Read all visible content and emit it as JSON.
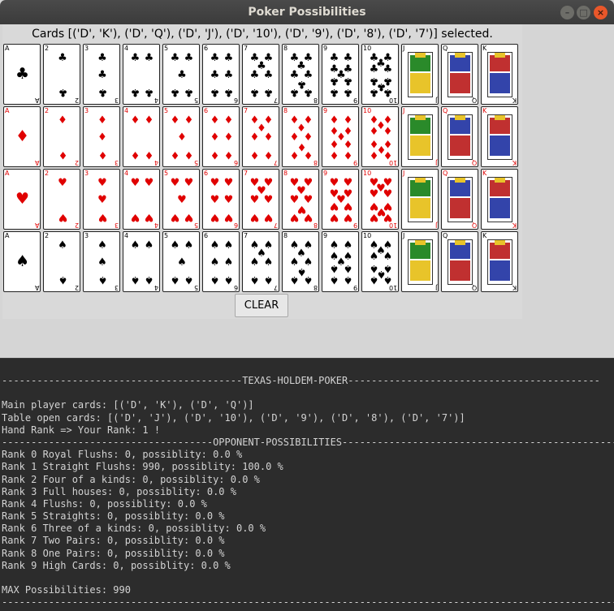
{
  "window": {
    "title": "Poker Possibilities",
    "controls": {
      "minimize": "–",
      "maximize": "□",
      "close": "×"
    }
  },
  "status_text": "Cards [('D', 'K'), ('D', 'Q'), ('D', 'J'), ('D', '10'), ('D', '9'), ('D', '8'), ('D', '7')] selected.",
  "ranks": [
    "A",
    "2",
    "3",
    "4",
    "5",
    "6",
    "7",
    "8",
    "9",
    "10",
    "J",
    "Q",
    "K"
  ],
  "rows": [
    {
      "suit": "clubs",
      "symbol": "♣",
      "color": "#000000"
    },
    {
      "suit": "diamonds",
      "symbol": "♦",
      "color": "#e00000"
    },
    {
      "suit": "hearts",
      "symbol": "♥",
      "color": "#e00000"
    },
    {
      "suit": "spades",
      "symbol": "♠",
      "color": "#000000"
    }
  ],
  "clear_label": "CLEAR",
  "terminal": {
    "lines": [
      "-----------------------------------------TEXAS-HOLDEM-POKER-------------------------------------------",
      "",
      "Main player cards: [('D', 'K'), ('D', 'Q')]",
      "Table open cards: [('D', 'J'), ('D', '10'), ('D', '9'), ('D', '8'), ('D', '7')]",
      "Hand Rank => Your Rank: 1 !",
      "------------------------------------OPPONENT-POSSIBILITIES------------------------------------------------",
      "Rank 0 Royal Flushs: 0, possiblity: 0.0 %",
      "Rank 1 Straight Flushs: 990, possiblity: 100.0 %",
      "Rank 2 Four of a kinds: 0, possiblity: 0.0 %",
      "Rank 3 Full houses: 0, possiblity: 0.0 %",
      "Rank 4 Flushs: 0, possiblity: 0.0 %",
      "Rank 5 Straights: 0, possiblity: 0.0 %",
      "Rank 6 Three of a kinds: 0, possiblity: 0.0 %",
      "Rank 7 Two Pairs: 0, possiblity: 0.0 %",
      "Rank 8 One Pairs: 0, possiblity: 0.0 %",
      "Rank 9 High Cards: 0, possiblity: 0.0 %",
      "",
      "MAX Possibilities: 990",
      "---------------------------------------------------------------------------------------------------------"
    ]
  }
}
